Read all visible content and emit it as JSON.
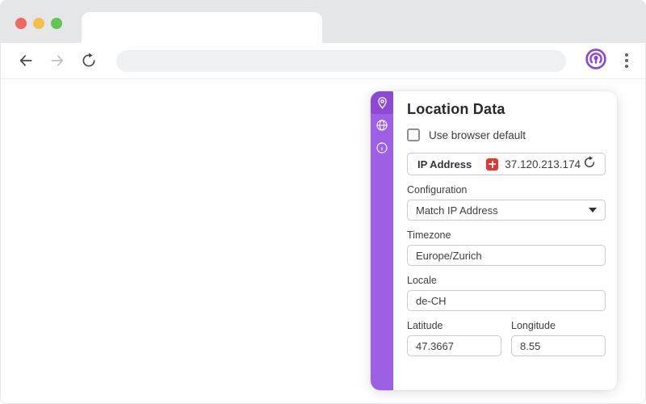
{
  "chrome": {
    "traffic_lights": {
      "close": "#ee6a5f",
      "minimize": "#f5bf4f",
      "zoom": "#61c554"
    },
    "address_bar": {
      "value": "",
      "placeholder": ""
    },
    "accent_color": "#8b44dd"
  },
  "panel": {
    "sidebar": {
      "color": "#9d5fe3",
      "active_color": "#8c4ad4",
      "items": [
        {
          "icon": "location-pin-icon",
          "active": true
        },
        {
          "icon": "globe-icon",
          "active": false
        },
        {
          "icon": "info-icon",
          "active": false
        }
      ]
    },
    "header": {
      "title": "Location Data"
    },
    "use_browser_default": {
      "label": "Use browser default",
      "checked": false
    },
    "ip": {
      "label": "IP Address",
      "flag": "CH",
      "value": "37.120.213.174"
    },
    "configuration": {
      "label": "Configuration",
      "value": "Match IP Address"
    },
    "timezone": {
      "label": "Timezone",
      "value": "Europe/Zurich"
    },
    "locale": {
      "label": "Locale",
      "value": "de-CH"
    },
    "latitude": {
      "label": "Latitude",
      "value": "47.3667"
    },
    "longitude": {
      "label": "Longitude",
      "value": "8.55"
    }
  }
}
